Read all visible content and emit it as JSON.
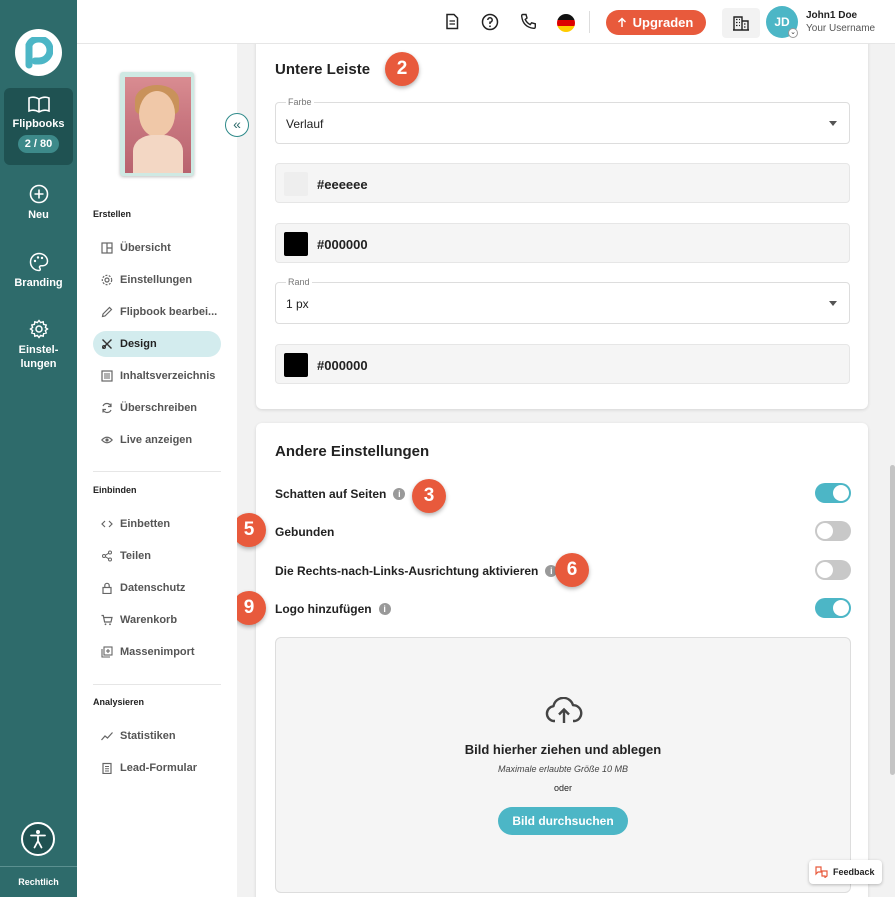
{
  "sidebar_rail": {
    "items": [
      {
        "label": "Flipbooks",
        "count": "2 / 80",
        "icon": "book-open-icon"
      },
      {
        "label": "Neu",
        "icon": "plus-circle-icon"
      },
      {
        "label": "Branding",
        "icon": "palette-icon"
      },
      {
        "label": "Einstel-lungen",
        "icon": "gear-icon"
      }
    ],
    "legal": "Rechtlich"
  },
  "topbar": {
    "upgrade_label": "Upgraden",
    "user_name": "John1 Doe",
    "user_sub": "Your Username",
    "avatar_initials": "JD"
  },
  "nav": {
    "sections": [
      {
        "title": "Erstellen",
        "items": [
          {
            "label": "Übersicht",
            "icon": "layout-icon"
          },
          {
            "label": "Einstellungen",
            "icon": "gear-icon"
          },
          {
            "label": "Flipbook bearbei...",
            "icon": "pencil-icon"
          },
          {
            "label": "Design",
            "icon": "design-tools-icon",
            "active": true
          },
          {
            "label": "Inhaltsverzeichnis",
            "icon": "list-icon"
          },
          {
            "label": "Überschreiben",
            "icon": "refresh-icon"
          },
          {
            "label": "Live anzeigen",
            "icon": "eye-icon"
          }
        ]
      },
      {
        "title": "Einbinden",
        "items": [
          {
            "label": "Einbetten",
            "icon": "code-icon"
          },
          {
            "label": "Teilen",
            "icon": "share-icon"
          },
          {
            "label": "Datenschutz",
            "icon": "lock-icon"
          },
          {
            "label": "Warenkorb",
            "icon": "cart-icon"
          },
          {
            "label": "Massenimport",
            "icon": "import-icon"
          }
        ]
      },
      {
        "title": "Analysieren",
        "items": [
          {
            "label": "Statistiken",
            "icon": "chart-line-icon"
          },
          {
            "label": "Lead-Formular",
            "icon": "clipboard-icon"
          }
        ]
      }
    ]
  },
  "lower_bar": {
    "title": "Untere Leiste",
    "badge": "2",
    "color_label": "Farbe",
    "color_value": "Verlauf",
    "color1": "#eeeeee",
    "color2": "#000000",
    "border_label": "Rand",
    "border_value": "1 px",
    "border_color": "#000000"
  },
  "other_settings": {
    "title": "Andere Einstellungen",
    "toggles": [
      {
        "label": "Schatten auf Seiten",
        "info": true,
        "on": true,
        "badge": "3"
      },
      {
        "label": "Gebunden",
        "info": false,
        "on": false,
        "badge": "5"
      },
      {
        "label": "Die Rechts-nach-Links-Ausrichtung aktivieren",
        "info": true,
        "on": false,
        "badge": "6"
      },
      {
        "label": "Logo hinzufügen",
        "info": true,
        "on": true,
        "badge": "9"
      }
    ],
    "upload": {
      "title": "Bild hierher ziehen und ablegen",
      "max_size": "Maximale erlaubte Größe 10 MB",
      "or": "oder",
      "browse_label": "Bild durchsuchen"
    }
  },
  "feedback_label": "Feedback",
  "colors": {
    "brand_teal": "#2e6b6b",
    "accent": "#4cb6c6",
    "orange": "#e85a3c"
  }
}
